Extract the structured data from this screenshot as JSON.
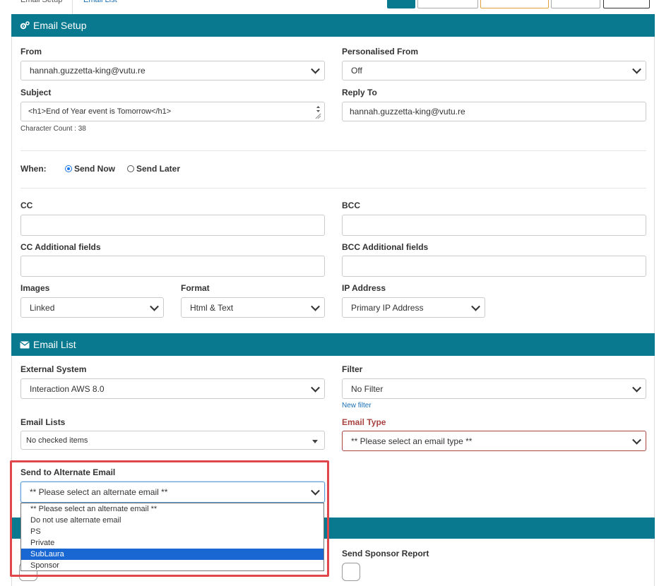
{
  "tabs": {
    "email_setup": "Email Setup",
    "email_list": "Email List"
  },
  "email_setup": {
    "header": "Email Setup",
    "from": {
      "label": "From",
      "value": "hannah.guzzetta-king@vutu.re"
    },
    "personalised_from": {
      "label": "Personalised From",
      "value": "Off"
    },
    "subject": {
      "label": "Subject",
      "value": "<h1>End of Year event is Tomorrow</h1>",
      "char_count": "Character Count : 38"
    },
    "reply_to": {
      "label": "Reply To",
      "value": "hannah.guzzetta-king@vutu.re"
    },
    "when": {
      "label": "When:",
      "send_now": "Send Now",
      "send_later": "Send Later",
      "selected": "Send Now"
    },
    "cc": {
      "label": "CC",
      "value": ""
    },
    "bcc": {
      "label": "BCC",
      "value": ""
    },
    "cc_additional": {
      "label": "CC Additional fields",
      "value": ""
    },
    "bcc_additional": {
      "label": "BCC Additional fields",
      "value": ""
    },
    "images": {
      "label": "Images",
      "value": "Linked"
    },
    "format": {
      "label": "Format",
      "value": "Html & Text"
    },
    "ip_address": {
      "label": "IP Address",
      "value": "Primary IP Address"
    }
  },
  "email_list": {
    "header": "Email List",
    "external_system": {
      "label": "External System",
      "value": "Interaction AWS 8.0"
    },
    "filter": {
      "label": "Filter",
      "value": "No Filter",
      "new_filter": "New filter"
    },
    "email_lists": {
      "label": "Email Lists",
      "value": "No checked items"
    },
    "email_type": {
      "label": "Email Type",
      "value": "** Please select an email type **"
    },
    "alternate_email": {
      "label": "Send to Alternate Email",
      "value": "** Please select an alternate email **",
      "options": [
        "** Please select an alternate email **",
        "Do not use alternate email",
        "PS",
        "Private",
        "SubLaura",
        "Sponsor"
      ],
      "highlighted": "SubLaura"
    }
  },
  "reports": {
    "send_sponsor_report": "Send Sponsor Report"
  },
  "colors": {
    "header_bg": "#08798f",
    "error": "#a94442",
    "highlight_box": "#e0474c",
    "option_selected": "#1967d2"
  }
}
